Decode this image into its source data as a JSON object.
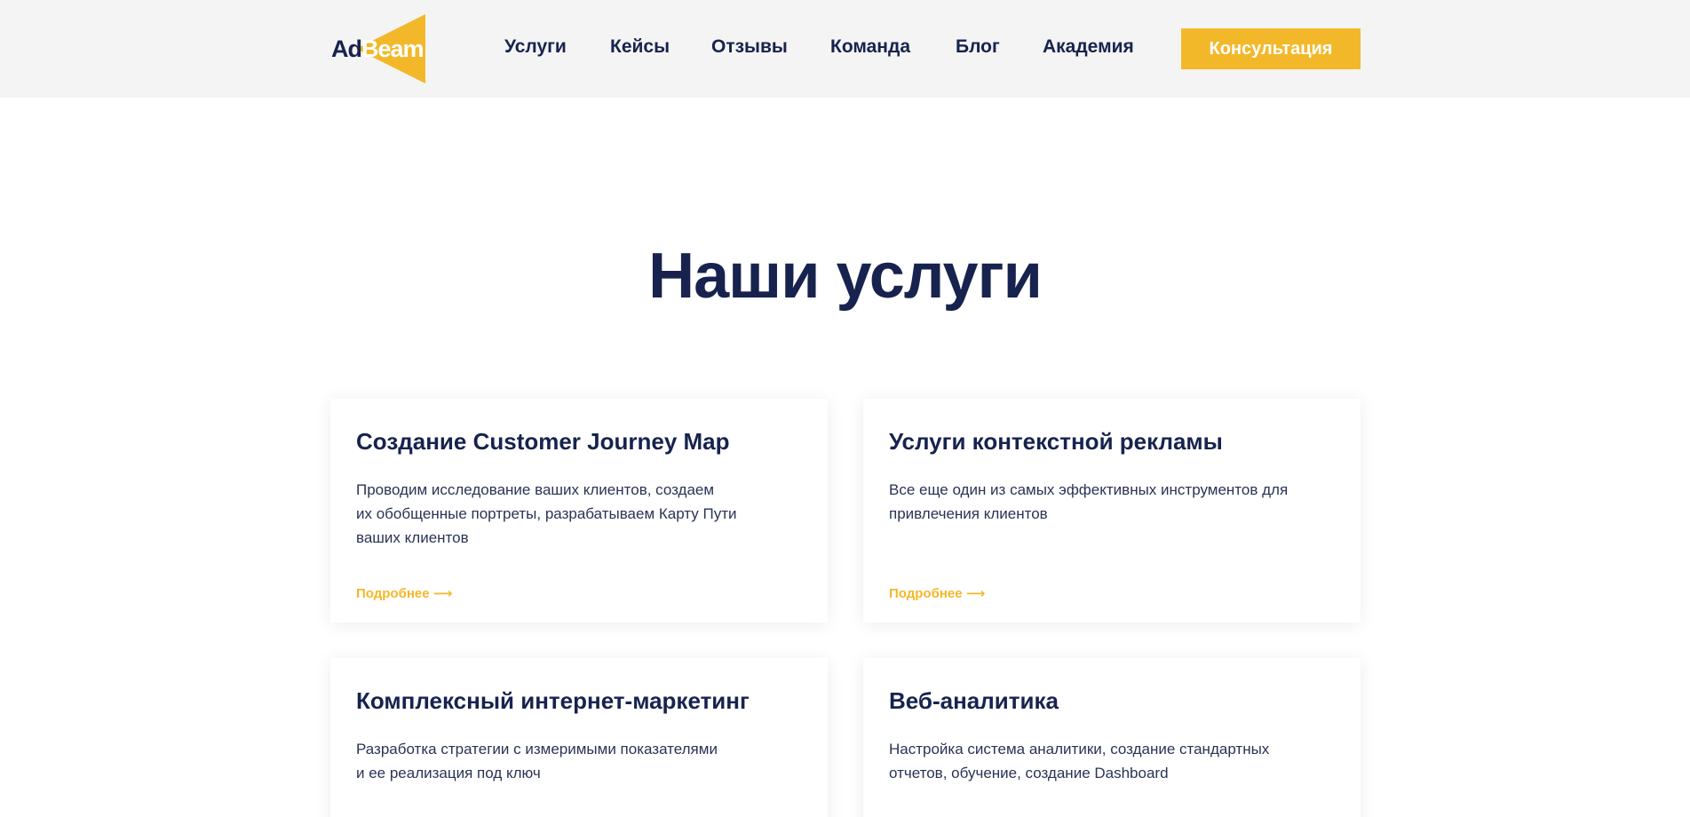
{
  "header": {
    "logo": {
      "ad": "Ad",
      "beam": "Beam",
      "accent_color": "#f3b82a"
    },
    "nav": [
      "Услуги",
      "Кейсы",
      "Отзывы",
      "Команда",
      "Блог",
      "Академия"
    ],
    "cta_label": "Консультация"
  },
  "main": {
    "title": "Наши услуги",
    "cards": [
      {
        "title": "Создание Customer Journey Map",
        "description": "Проводим исследование ваших клиентов, создаем\nих обобщенные портреты, разрабатываем Карту Пути\nваших клиентов",
        "link": "Подробнее ⟶"
      },
      {
        "title": "Услуги контекстной рекламы",
        "description": "Все еще один из самых эффективных инструментов для\nпривлечения клиентов",
        "link": "Подробнее ⟶"
      },
      {
        "title": "Комплексный интернет-маркетинг",
        "description": "Разработка стратегии с измеримыми показателями\nи ее реализация под ключ",
        "link": ""
      },
      {
        "title": "Веб-аналитика",
        "description": "Настройка система аналитики, создание стандартных\nотчетов, обучение, создание Dashboard",
        "link": ""
      }
    ]
  },
  "colors": {
    "navy": "#17234e",
    "accent": "#f3b82a",
    "header_bg": "#f4f4f4"
  }
}
